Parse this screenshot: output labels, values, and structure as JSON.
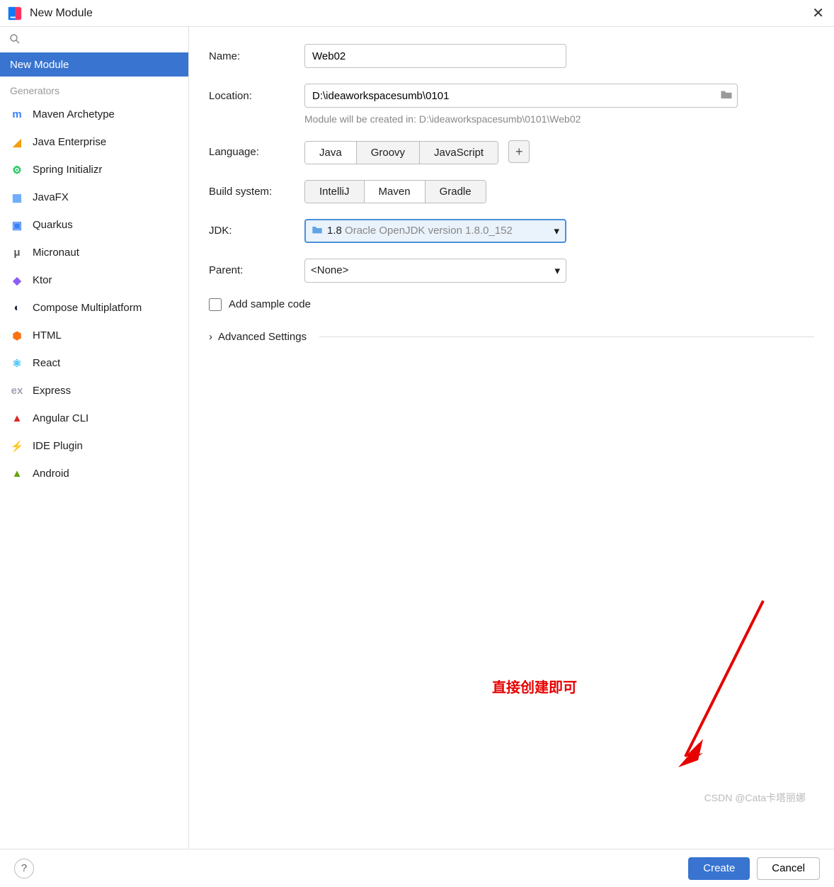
{
  "window": {
    "title": "New Module"
  },
  "sidebar": {
    "main": "New Module",
    "section": "Generators",
    "items": [
      {
        "label": "Maven Archetype",
        "color": "#3b82f6"
      },
      {
        "label": "Java Enterprise",
        "color": "#f59e0b"
      },
      {
        "label": "Spring Initializr",
        "color": "#22c55e"
      },
      {
        "label": "JavaFX",
        "color": "#60a5fa"
      },
      {
        "label": "Quarkus",
        "color": "#3b82f6"
      },
      {
        "label": "Micronaut",
        "color": "#555"
      },
      {
        "label": "Ktor",
        "color": "#8b5cf6"
      },
      {
        "label": "Compose Multiplatform",
        "color": "#1e293b"
      },
      {
        "label": "HTML",
        "color": "#f97316"
      },
      {
        "label": "React",
        "color": "#38bdf8"
      },
      {
        "label": "Express",
        "color": "#9ca3af"
      },
      {
        "label": "Angular CLI",
        "color": "#dc2626"
      },
      {
        "label": "IDE Plugin",
        "color": "#9ca3af"
      },
      {
        "label": "Android",
        "color": "#65a30d"
      }
    ]
  },
  "form": {
    "name_label": "Name:",
    "name_value": "Web02",
    "location_label": "Location:",
    "location_value": "D:\\ideaworkspacesumb\\0101",
    "location_hint": "Module will be created in: D:\\ideaworkspacesumb\\0101\\Web02",
    "language_label": "Language:",
    "language_options": [
      "Java",
      "Groovy",
      "JavaScript"
    ],
    "language_selected": "Java",
    "build_label": "Build system:",
    "build_options": [
      "IntelliJ",
      "Maven",
      "Gradle"
    ],
    "build_selected": "Maven",
    "jdk_label": "JDK:",
    "jdk_version": "1.8",
    "jdk_desc": " Oracle OpenJDK version 1.8.0_152",
    "parent_label": "Parent:",
    "parent_value": "<None>",
    "sample_label": "Add sample code",
    "advanced_label": "Advanced Settings"
  },
  "annotation": "直接创建即可",
  "watermark": "CSDN @Cata卡塔丽娜",
  "footer": {
    "create": "Create",
    "cancel": "Cancel"
  }
}
